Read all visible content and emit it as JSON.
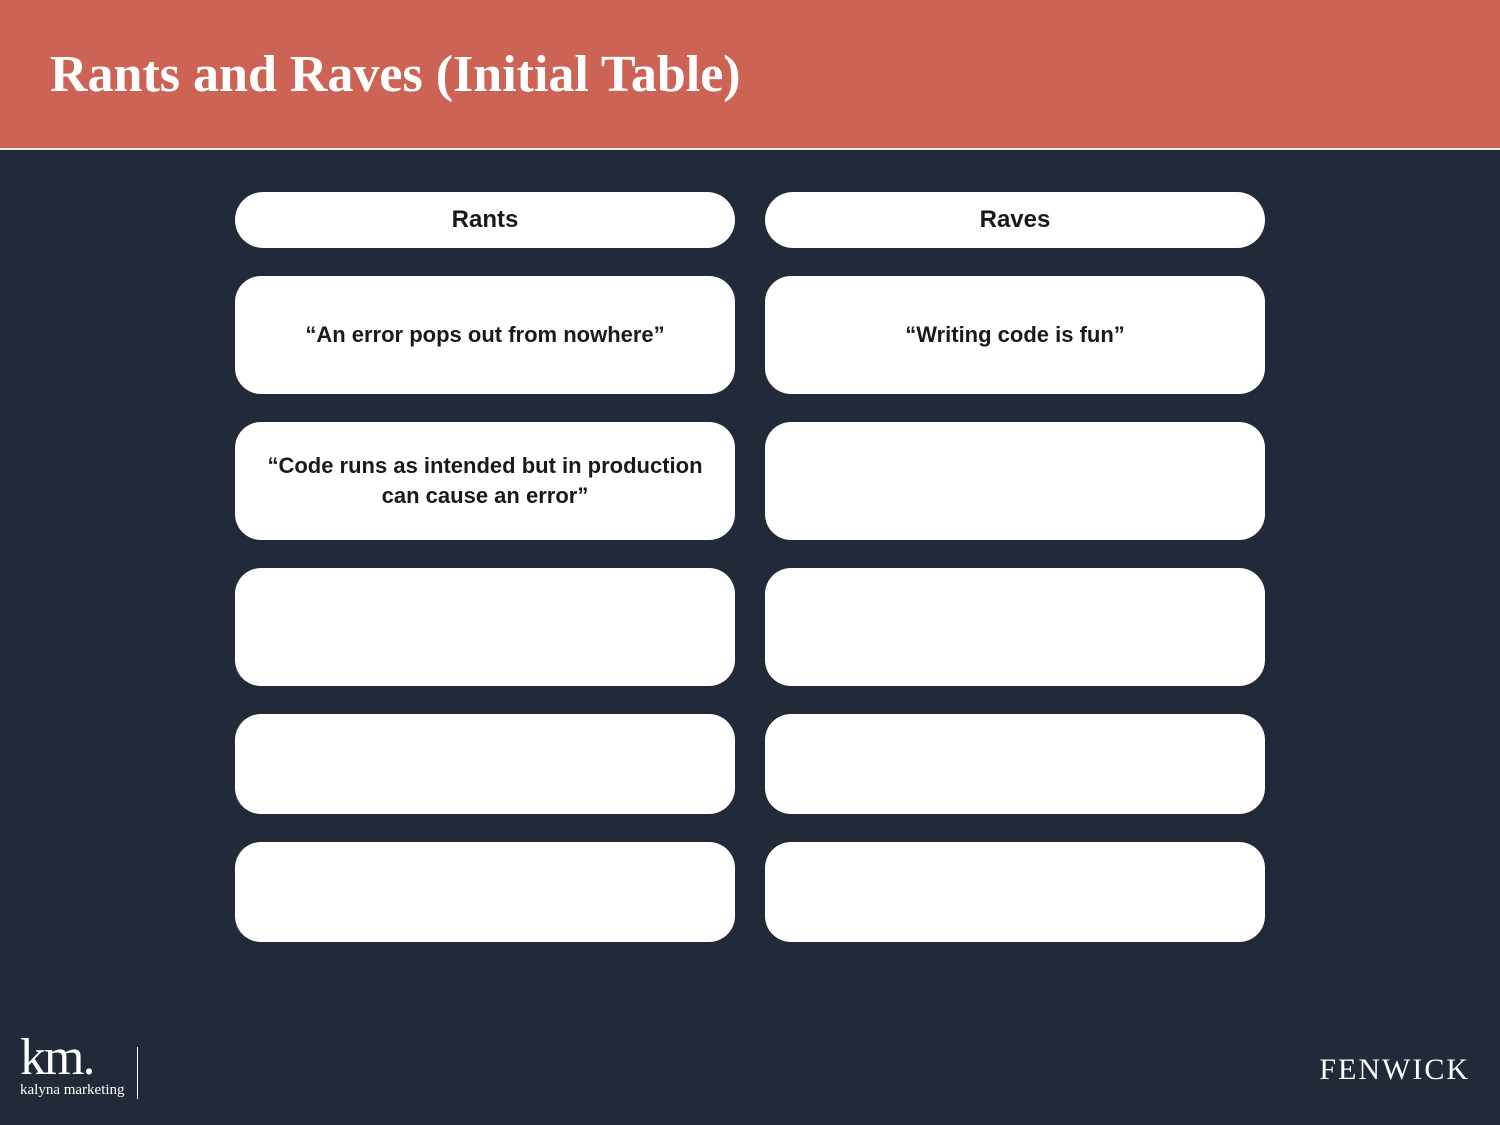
{
  "header": {
    "title": "Rants and Raves (Initial Table)"
  },
  "table": {
    "columns": [
      {
        "header": "Rants",
        "rows": [
          "“An error pops out from nowhere”",
          "“Code runs as intended but in production can cause an error”",
          "",
          "",
          ""
        ]
      },
      {
        "header": "Raves",
        "rows": [
          "“Writing code is fun”",
          "",
          "",
          "",
          ""
        ]
      }
    ]
  },
  "branding": {
    "left_mark": "km.",
    "left_sub": "kalyna marketing",
    "right": "FENWICK"
  },
  "colors": {
    "header_bg": "#cd6355",
    "body_bg": "#222a3a",
    "card_bg": "#ffffff"
  }
}
